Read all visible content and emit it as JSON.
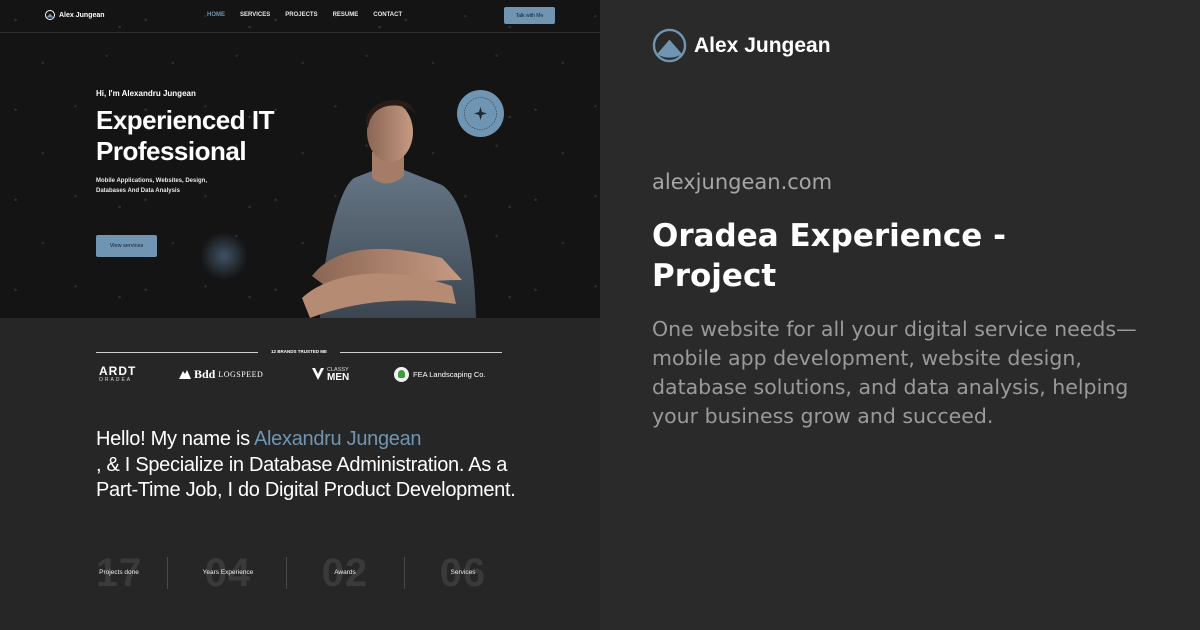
{
  "preview": {
    "nav": {
      "logo_text": "Alex Jungean",
      "links": [
        "HOME",
        "SERVICES",
        "PROJECTS",
        "RESUME",
        "CONTACT"
      ],
      "active_link": "HOME",
      "cta": "Talk with Me"
    },
    "hero": {
      "greeting": "Hi, I'm Alexandru Jungean",
      "title_line1": "Experienced IT",
      "title_line2": "Professional",
      "subtitle": "Mobile Applications, Websites, Design, Databases And Data Analysis",
      "button": "View services"
    },
    "trusted": {
      "label": "12 BRANDS TRUSTED ME",
      "brands": {
        "ardt_main": "ARDT",
        "ardt_sub": "ORADEA",
        "bdd_main": "Bdd",
        "bdd_sub": "LOGSPEED",
        "classy_top": "CLASSY",
        "classy_main": "MEN",
        "fea": "FEA Landscaping Co."
      }
    },
    "about": {
      "part1": "Hello! My name is ",
      "highlight": "Alexandru Jungean",
      "part2": ", & I Specialize in Database Administration. As a Part-Time Job, I do Digital Product Development."
    },
    "stats": [
      {
        "number": "17",
        "label": "Projects done"
      },
      {
        "number": "04",
        "label": "Years Experience"
      },
      {
        "number": "02",
        "label": "Awards"
      },
      {
        "number": "06",
        "label": "Services"
      }
    ]
  },
  "card": {
    "logo_text": "Alex Jungean",
    "domain": "alexjungean.com",
    "title": "Oradea Experience - Project",
    "description": "One website for all your digital service needs—mobile app development, website design, database solutions, and data analysis, helping your business grow and succeed."
  },
  "colors": {
    "accent": "#6f95b3",
    "background": "#2a2a2a",
    "hero_background": "#141414"
  },
  "icons": [
    "mountain-logo-icon",
    "wave-icon",
    "star-icon",
    "fea-leaf-icon"
  ]
}
